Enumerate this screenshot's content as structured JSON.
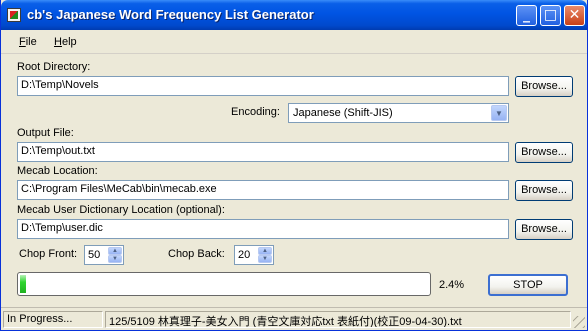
{
  "window": {
    "title": "cb's Japanese Word Frequency List Generator",
    "minimize_label": "_",
    "maximize_label": "□",
    "close_label": "✕"
  },
  "menu": {
    "file": "File",
    "help": "Help"
  },
  "form": {
    "root_directory_label": "Root Directory:",
    "root_directory_value": "D:\\Temp\\Novels",
    "encoding_label": "Encoding:",
    "encoding_value": "Japanese (Shift-JIS)",
    "output_file_label": "Output File:",
    "output_file_value": "D:\\Temp\\out.txt",
    "mecab_location_label": "Mecab Location:",
    "mecab_location_value": "C:\\Program Files\\MeCab\\bin\\mecab.exe",
    "mecab_dict_label": "Mecab User Dictionary Location (optional):",
    "mecab_dict_value": "D:\\Temp\\user.dic",
    "browse_label": "Browse...",
    "chop_front_label": "Chop Front:",
    "chop_front_value": "50",
    "chop_back_label": "Chop Back:",
    "chop_back_value": "20"
  },
  "progress": {
    "fraction": 0.024,
    "percent_text": "2.4%",
    "stop_label": "STOP"
  },
  "status": {
    "state": "In Progress...",
    "current_file": "125/5109  林真理子-美女入門 (青空文庫対応txt 表紙付)(校正09-04-30).txt"
  },
  "colors": {
    "titlebar": "#0054e3",
    "progress_fill": "#2ed52e",
    "window_bg": "#ece9d8"
  }
}
